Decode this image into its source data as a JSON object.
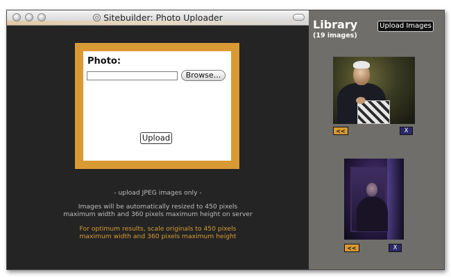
{
  "window": {
    "title": "Sitebuilder: Photo Uploader"
  },
  "uploader": {
    "photo_label": "Photo:",
    "file_value": "",
    "browse_label": "Browse...",
    "upload_label": "Upload"
  },
  "notes": {
    "jpeg_only": "- upload JPEG images only -",
    "resize_line1": "Images will be automatically resized to 450 pixels",
    "resize_line2": "maximum width and 360 pixels maximum height on server",
    "optimum_line1": "For optimum results, scale originals to 450 pixels",
    "optimum_line2": "maximum width and 360 pixels maximum height"
  },
  "library": {
    "title": "Library",
    "count": "(19 images)",
    "upload_images_label": "Upload Images",
    "items": [
      {
        "prev_label": "<<",
        "delete_label": "X"
      },
      {
        "prev_label": "<<",
        "delete_label": "X"
      }
    ]
  },
  "colors": {
    "accent": "#d99a35",
    "main_bg": "#242424",
    "library_bg": "#6f6e6a",
    "delete_btn": "#2a2a6a"
  }
}
